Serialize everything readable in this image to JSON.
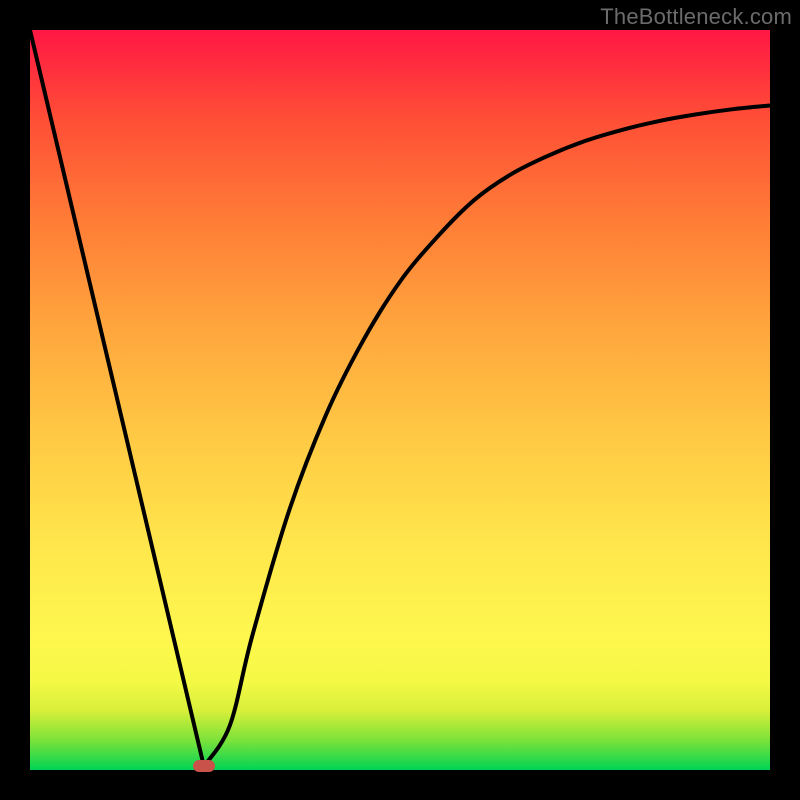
{
  "watermark": "TheBottleneck.com",
  "chart_data": {
    "type": "line",
    "title": "",
    "xlabel": "",
    "ylabel": "",
    "xlim": [
      0,
      100
    ],
    "ylim": [
      0,
      100
    ],
    "grid": false,
    "legend": false,
    "background_gradient": {
      "direction": "vertical",
      "stops": [
        {
          "pos": 0,
          "color": "#00d455"
        },
        {
          "pos": 12,
          "color": "#f4f945"
        },
        {
          "pos": 45,
          "color": "#ffc944"
        },
        {
          "pos": 75,
          "color": "#ff7a36"
        },
        {
          "pos": 100,
          "color": "#ff1744"
        }
      ]
    },
    "series": [
      {
        "name": "bottleneck-curve",
        "color": "#000000",
        "x": [
          0,
          5,
          10,
          15,
          20,
          23.5,
          27,
          30,
          35,
          40,
          45,
          50,
          55,
          60,
          65,
          70,
          75,
          80,
          85,
          90,
          95,
          100
        ],
        "y": [
          100,
          79,
          57,
          36,
          15,
          0.5,
          6,
          18,
          35,
          48,
          58,
          66,
          72,
          77,
          80.5,
          83,
          85,
          86.5,
          87.7,
          88.6,
          89.3,
          89.8
        ]
      }
    ],
    "marker": {
      "x": 23.5,
      "y": 0.5,
      "color": "#c9524b"
    }
  }
}
